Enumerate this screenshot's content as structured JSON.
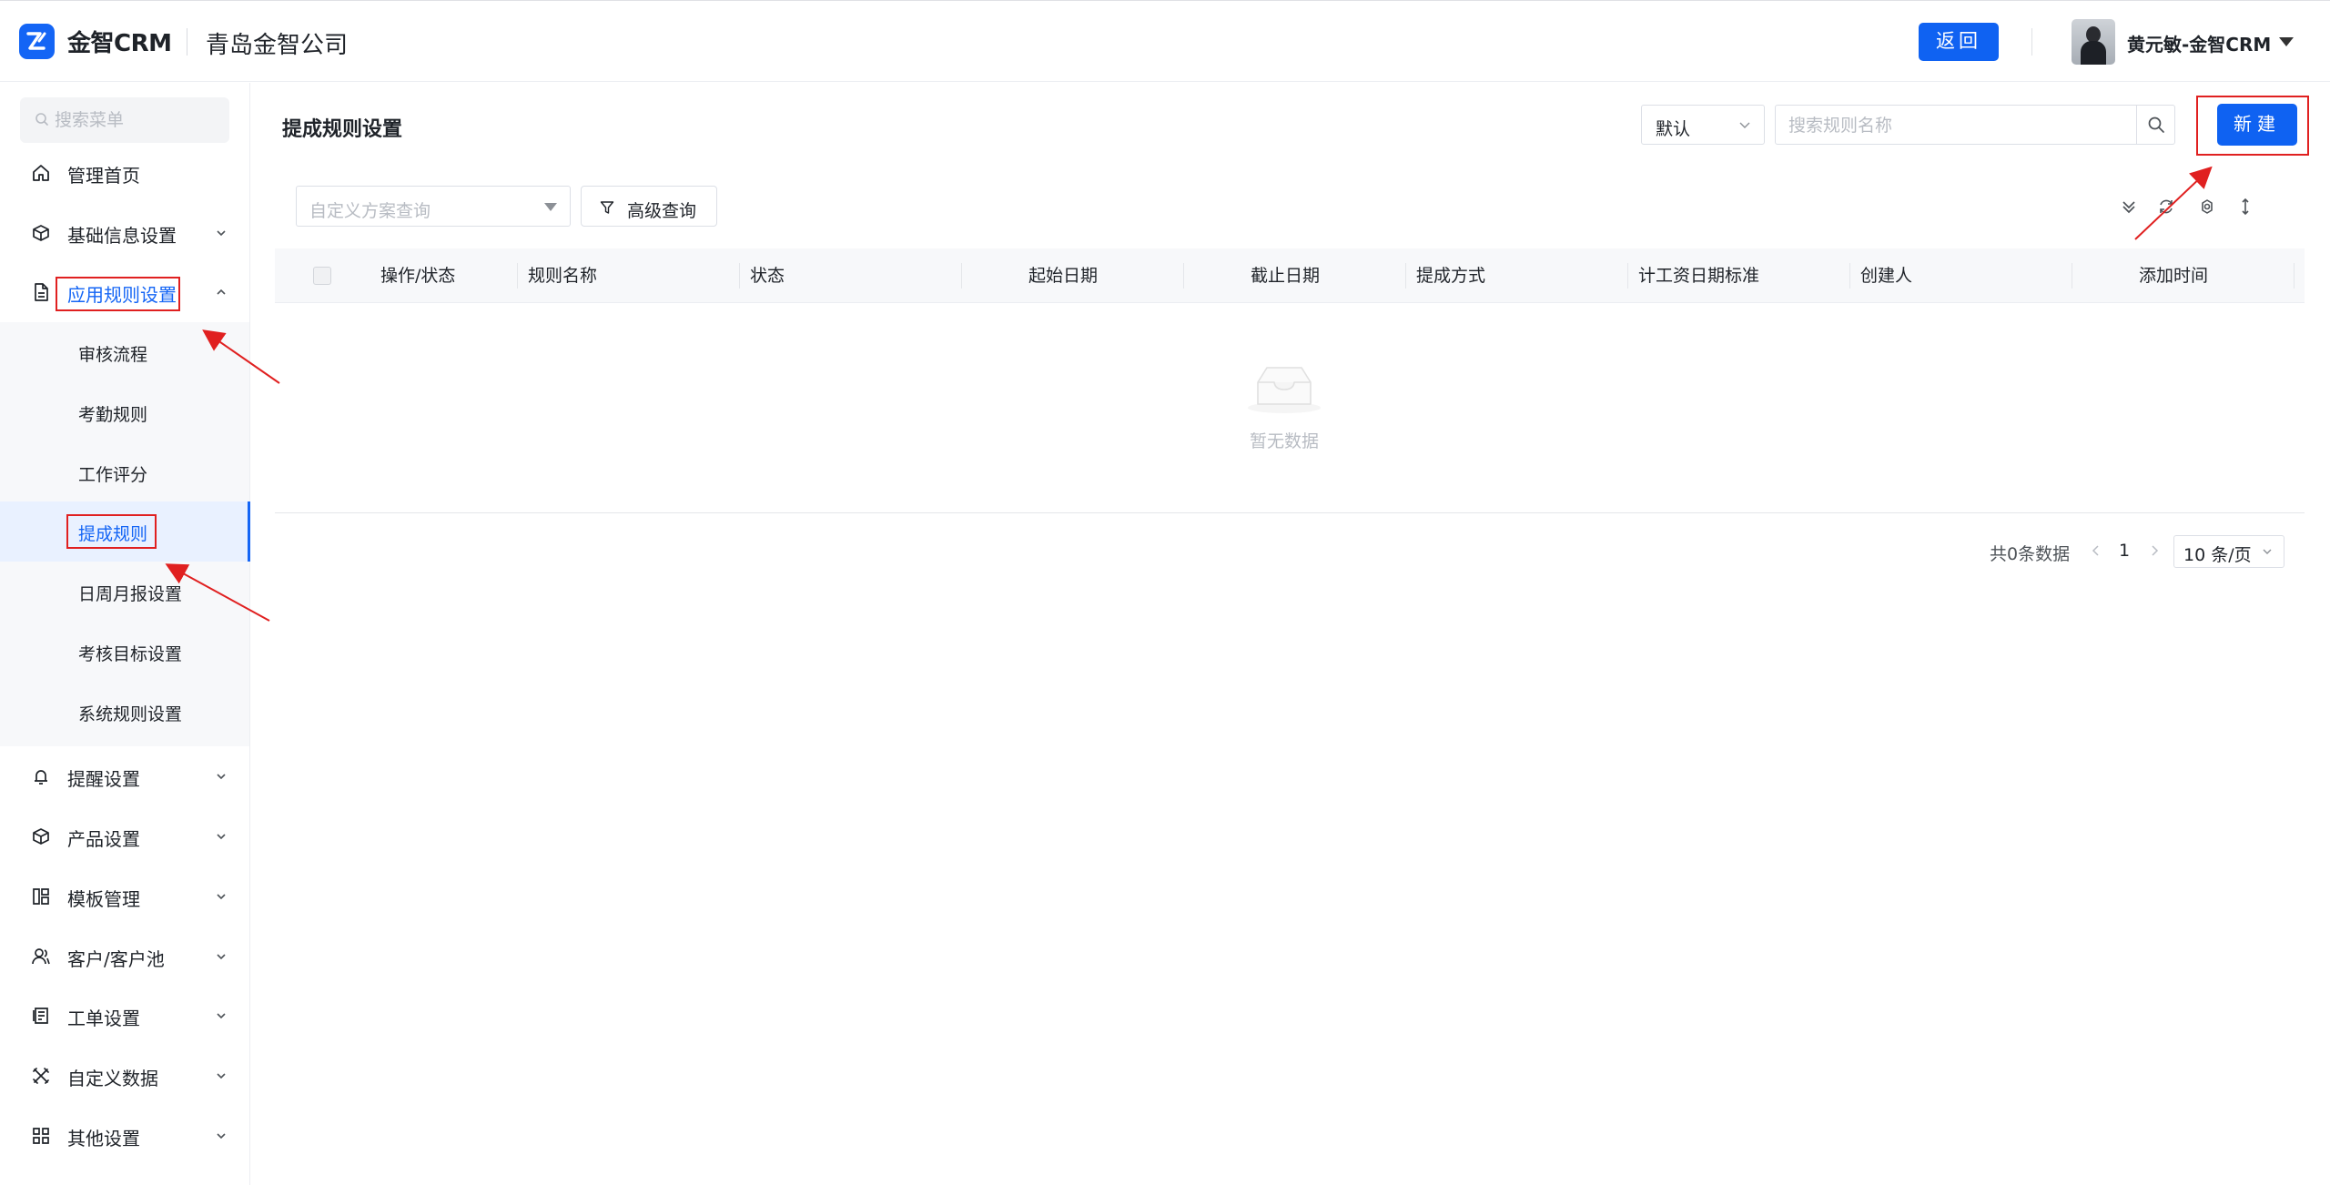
{
  "header": {
    "logo_text": "金智CRM",
    "company": "青岛金智公司",
    "back_label": "返回",
    "user_name": "黄元敏-金智CRM"
  },
  "sidebar": {
    "search_placeholder": "搜索菜单",
    "items": [
      {
        "label": "管理首页"
      },
      {
        "label": "基础信息设置"
      },
      {
        "label": "应用规则设置"
      },
      {
        "label": "提醒设置"
      },
      {
        "label": "产品设置"
      },
      {
        "label": "模板管理"
      },
      {
        "label": "客户/客户池"
      },
      {
        "label": "工单设置"
      },
      {
        "label": "自定义数据"
      },
      {
        "label": "其他设置"
      }
    ],
    "submenu": [
      {
        "label": "审核流程"
      },
      {
        "label": "考勤规则"
      },
      {
        "label": "工作评分"
      },
      {
        "label": "提成规则"
      },
      {
        "label": "日周月报设置"
      },
      {
        "label": "考核目标设置"
      },
      {
        "label": "系统规则设置"
      }
    ]
  },
  "main": {
    "title": "提成规则设置",
    "filter_select": "默认",
    "search_placeholder": "搜索规则名称",
    "new_label": "新建",
    "scheme_placeholder": "自定义方案查询",
    "advanced_query": "高级查询",
    "columns": [
      "操作/状态",
      "规则名称",
      "状态",
      "起始日期",
      "截止日期",
      "提成方式",
      "计工资日期标准",
      "创建人",
      "添加时间"
    ],
    "empty_text": "暂无数据",
    "pagination": {
      "total": "共0条数据",
      "page": "1",
      "page_size": "10 条/页"
    }
  },
  "colors": {
    "primary": "#1465f5",
    "annotation": "#e02020"
  }
}
